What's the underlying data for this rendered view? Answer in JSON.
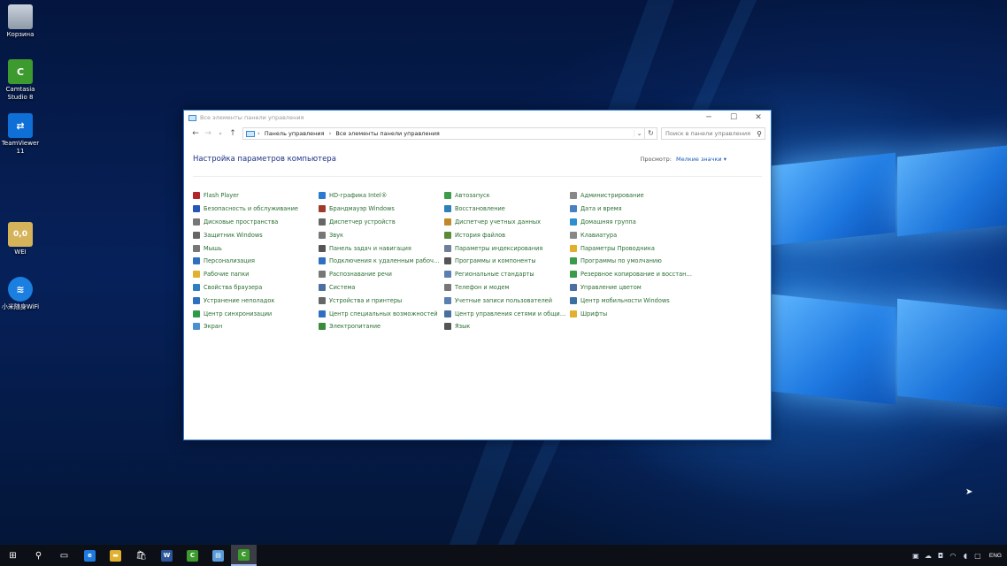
{
  "desktop": {
    "icons": [
      {
        "label": "Корзина",
        "icon": "recycle-bin-icon",
        "color": "#9aa7b8",
        "glyph": ""
      },
      {
        "label": "Camtasia Studio 8",
        "icon": "camtasia-icon",
        "color": "#3d9a2f",
        "glyph": "C"
      },
      {
        "label": "TeamViewer 11",
        "icon": "teamviewer-icon",
        "color": "#0e6fd6",
        "glyph": "⇄"
      },
      {
        "label": "WEI",
        "icon": "wei-icon",
        "color": "#d5b35b",
        "glyph": "0,0"
      },
      {
        "label": "小米随身WiFi",
        "icon": "wifi-icon",
        "color": "#1a7fe0",
        "glyph": "≋"
      }
    ]
  },
  "window": {
    "title": "Все элементы панели управления",
    "controls": {
      "minimize": "─",
      "maximize": "☐",
      "close": "✕"
    },
    "breadcrumb": [
      "Панель управления",
      "Все элементы панели управления"
    ],
    "search_placeholder": "Поиск в панели управления",
    "page_title": "Настройка параметров компьютера",
    "view_label": "Просмотр:",
    "view_value": "Мелкие значки ▾",
    "items": [
      {
        "label": "Flash Player",
        "color": "#b2262b"
      },
      {
        "label": "HD-графика Intel®",
        "color": "#2a7bd0"
      },
      {
        "label": "Автозапуск",
        "color": "#3e9b4a"
      },
      {
        "label": "Администрирование",
        "color": "#888888"
      },
      {
        "label": "Безопасность и обслуживание",
        "color": "#2457b8"
      },
      {
        "label": "Брандмауэр Windows",
        "color": "#a03b2b"
      },
      {
        "label": "Восстановление",
        "color": "#2f7fb8"
      },
      {
        "label": "Дата и время",
        "color": "#4b7fc4"
      },
      {
        "label": "Дисковые пространства",
        "color": "#777777"
      },
      {
        "label": "Диспетчер устройств",
        "color": "#666666"
      },
      {
        "label": "Диспетчер учетных данных",
        "color": "#c08a2a"
      },
      {
        "label": "Домашняя группа",
        "color": "#2e8fd0"
      },
      {
        "label": "Защитник Windows",
        "color": "#666666"
      },
      {
        "label": "Звук",
        "color": "#777777"
      },
      {
        "label": "История файлов",
        "color": "#5a8b3a"
      },
      {
        "label": "Клавиатура",
        "color": "#888888"
      },
      {
        "label": "Мышь",
        "color": "#777777"
      },
      {
        "label": "Панель задач и навигация",
        "color": "#555555"
      },
      {
        "label": "Параметры индексирования",
        "color": "#6f7f99"
      },
      {
        "label": "Параметры Проводника",
        "color": "#e0b02e"
      },
      {
        "label": "Персонализация",
        "color": "#2f6fc0"
      },
      {
        "label": "Подключения к удаленным рабоч…",
        "color": "#2f6fc0"
      },
      {
        "label": "Программы и компоненты",
        "color": "#555555"
      },
      {
        "label": "Программы по умолчанию",
        "color": "#3a9b4a"
      },
      {
        "label": "Рабочие папки",
        "color": "#e0b02e"
      },
      {
        "label": "Распознавание речи",
        "color": "#777777"
      },
      {
        "label": "Региональные стандарты",
        "color": "#5a7fb0"
      },
      {
        "label": "Резервное копирование и восстан…",
        "color": "#3a9b4a"
      },
      {
        "label": "Свойства браузера",
        "color": "#2f7fc0"
      },
      {
        "label": "Система",
        "color": "#4a6fa0"
      },
      {
        "label": "Телефон и модем",
        "color": "#777777"
      },
      {
        "label": "Управление цветом",
        "color": "#4a6fa0"
      },
      {
        "label": "Устранение неполадок",
        "color": "#2f6fc0"
      },
      {
        "label": "Устройства и принтеры",
        "color": "#666666"
      },
      {
        "label": "Учетные записи пользователей",
        "color": "#5a7fb0"
      },
      {
        "label": "Центр мобильности Windows",
        "color": "#3a6fa0"
      },
      {
        "label": "Центр синхронизации",
        "color": "#2e9b4a"
      },
      {
        "label": "Центр специальных возможностей",
        "color": "#2f6fc0"
      },
      {
        "label": "Центр управления сетями и общи…",
        "color": "#4a6fa0"
      },
      {
        "label": "Шрифты",
        "color": "#e0b02e"
      },
      {
        "label": "Экран",
        "color": "#4a8fd0"
      },
      {
        "label": "Электропитание",
        "color": "#3a8b3a"
      },
      {
        "label": "Язык",
        "color": "#555555"
      }
    ]
  },
  "taskbar": {
    "items": [
      {
        "name": "start-button",
        "glyph": "⊞",
        "color": ""
      },
      {
        "name": "search-icon",
        "glyph": "⚲",
        "color": ""
      },
      {
        "name": "task-view-icon",
        "glyph": "▭",
        "color": ""
      },
      {
        "name": "edge-icon",
        "glyph": "e",
        "color": "#1f7ae0"
      },
      {
        "name": "file-explorer-icon",
        "glyph": "▬",
        "color": "#e0b02e"
      },
      {
        "name": "store-icon",
        "glyph": "🛍",
        "color": ""
      },
      {
        "name": "word-icon",
        "glyph": "W",
        "color": "#2b579a"
      },
      {
        "name": "camtasia-taskbar-icon",
        "glyph": "C",
        "color": "#3d9a2f"
      },
      {
        "name": "control-panel-taskbar-icon",
        "glyph": "▤",
        "color": "#5a9bd8"
      },
      {
        "name": "camtasia-recorder-taskbar-icon",
        "glyph": "C",
        "color": "#3d9a2f"
      }
    ],
    "tray_icons": [
      "network-app-icon",
      "onedrive-icon",
      "media-icon",
      "wifi-icon",
      "volume-icon",
      "message-icon"
    ],
    "tray_glyphs": [
      "▣",
      "☁",
      "◘",
      "◠",
      "◖",
      "▢"
    ],
    "language": "ENG"
  }
}
